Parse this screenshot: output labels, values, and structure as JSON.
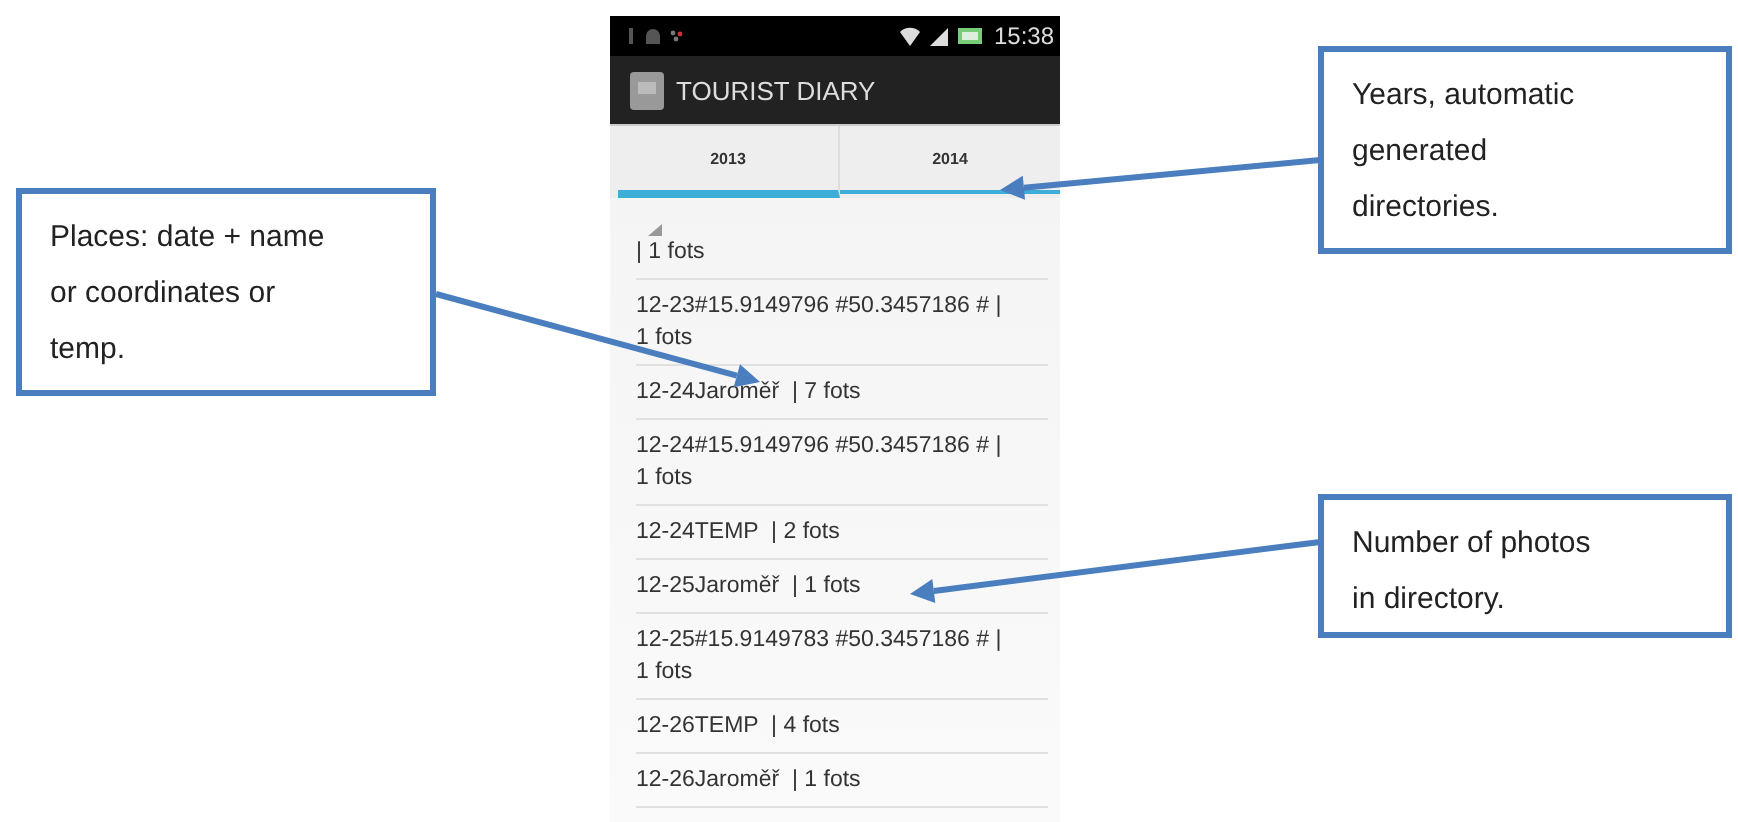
{
  "phone": {
    "status_bar": {
      "time": "15:38"
    },
    "app_bar": {
      "title": "TOURIST DIARY"
    },
    "tabs": [
      {
        "label": "2013",
        "selected": true
      },
      {
        "label": "2014",
        "selected": false
      }
    ],
    "list": [
      {
        "text": "| 1 fots",
        "expander": true
      },
      {
        "text": "12-23#15.9149796 #50.3457186 # | 1 fots",
        "expander": false
      },
      {
        "text": "12-24Jaroměř  | 7 fots",
        "expander": false
      },
      {
        "text": "12-24#15.9149796 #50.3457186 # | 1 fots",
        "expander": false
      },
      {
        "text": "12-24TEMP  | 2 fots",
        "expander": false
      },
      {
        "text": "12-25Jaroměř  | 1 fots",
        "expander": false
      },
      {
        "text": "12-25#15.9149783 #50.3457186 # | 1 fots",
        "expander": false
      },
      {
        "text": "12-26TEMP  | 4 fots",
        "expander": false
      },
      {
        "text": "12-26Jaroměř  | 1 fots",
        "expander": false
      }
    ]
  },
  "callouts": [
    {
      "text": "Places: date + name or coordinates or temp."
    },
    {
      "text": "Years, automatic generated directories."
    },
    {
      "text": "Number of photos in directory."
    }
  ]
}
